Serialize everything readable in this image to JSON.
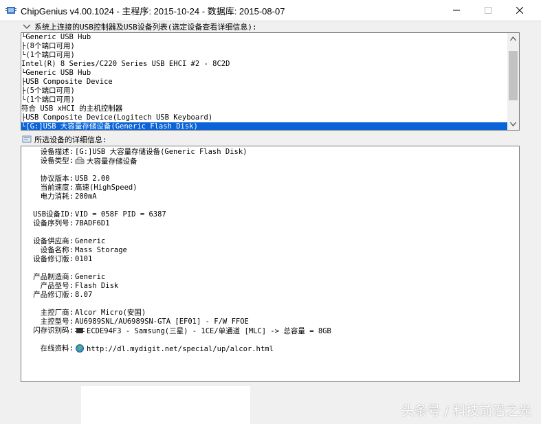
{
  "window": {
    "title": "ChipGenius v4.00.1024 - 主程序: 2015-10-24 - 数据库: 2015-08-07"
  },
  "devices_section": {
    "label": "系统上连接的USB控制器及USB设备列表(选定设备查看详细信息):",
    "items": [
      "└Generic USB Hub",
      "  ├(8个端口可用)",
      "  └(1个端口可用)",
      "Intel(R) 8 Series/C220 Series USB EHCI #2 - 8C2D",
      "└Generic USB Hub",
      "  ├USB Composite Device",
      "  ├(5个端口可用)",
      "  └(1个端口可用)",
      "符合 USB xHCI 的主机控制器",
      "├USB Composite Device(Logitech USB Keyboard)",
      "└[G:]USB 大容量存储设备(Generic Flash Disk)"
    ],
    "selected_index": 10
  },
  "details_section": {
    "label": "所选设备的详细信息:",
    "rows": [
      {
        "key": "设备描述:",
        "value": "[G:]USB 大容量存储设备(Generic Flash Disk)"
      },
      {
        "key": "设备类型:",
        "value": "大容量存储设备"
      },
      {
        "key": "协议版本:",
        "value": "USB 2.00"
      },
      {
        "key": "当前速度:",
        "value": "高速(HighSpeed)"
      },
      {
        "key": "电力消耗:",
        "value": "200mA"
      },
      {
        "key": "USB设备ID:",
        "value": "VID = 058F PID = 6387"
      },
      {
        "key": "设备序列号:",
        "value": "7BADF6D1"
      },
      {
        "key": "设备供应商:",
        "value": "Generic"
      },
      {
        "key": "设备名称:",
        "value": "Mass Storage"
      },
      {
        "key": "设备修订版:",
        "value": "0101"
      },
      {
        "key": "产品制造商:",
        "value": "Generic"
      },
      {
        "key": "产品型号:",
        "value": "Flash Disk"
      },
      {
        "key": "产品修订版:",
        "value": "8.07"
      },
      {
        "key": "主控厂商:",
        "value": "Alcor Micro(安国)"
      },
      {
        "key": "主控型号:",
        "value": "AU6989SNL/AU6989SN-GTA [EF01] - F/W FFOE"
      },
      {
        "key": "闪存识别码:",
        "value": "ECDE94F3 - Samsung(三星) - 1CE/单通道 [MLC] -> 总容量 = 8GB"
      },
      {
        "key": "在线资料:",
        "value": "http://dl.mydigit.net/special/up/alcor.html"
      }
    ]
  },
  "watermark": "头条号 / 科技前沿之光",
  "colors": {
    "selection": "#0a64d8",
    "window_bg": "#f0f0f0",
    "panel_bg": "#ffffff"
  }
}
